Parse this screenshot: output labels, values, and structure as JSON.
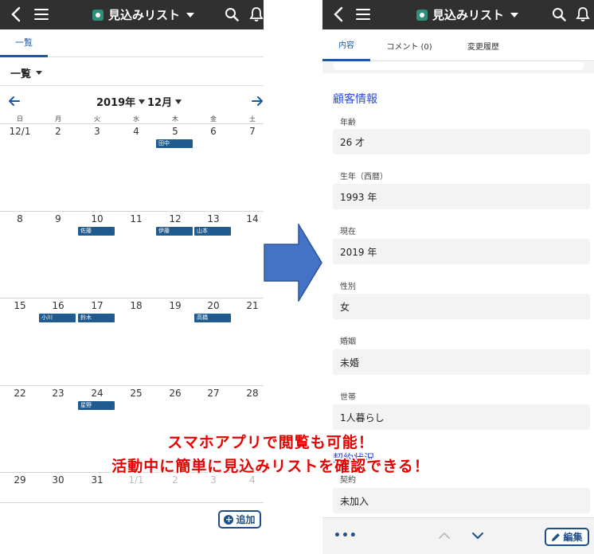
{
  "app_title": "見込みリスト",
  "left": {
    "tab_label": "一覧",
    "view_label": "一覧",
    "year_label": "2019年",
    "month_label": "12月",
    "weekdays": [
      "日",
      "月",
      "火",
      "水",
      "木",
      "金",
      "土"
    ],
    "weeks": [
      [
        "12/1",
        "2",
        "3",
        "4",
        "5",
        "6",
        "7"
      ],
      [
        "8",
        "9",
        "10",
        "11",
        "12",
        "13",
        "14"
      ],
      [
        "15",
        "16",
        "17",
        "18",
        "19",
        "20",
        "21"
      ],
      [
        "22",
        "23",
        "24",
        "25",
        "26",
        "27",
        "28"
      ],
      [
        "29",
        "30",
        "31",
        "1/1",
        "2",
        "3",
        "4"
      ]
    ],
    "events": [
      {
        "week": 0,
        "day": 4,
        "name": "田中"
      },
      {
        "week": 1,
        "day": 2,
        "name": "佐藤"
      },
      {
        "week": 1,
        "day": 4,
        "name": "伊藤"
      },
      {
        "week": 1,
        "day": 5,
        "name": "山本"
      },
      {
        "week": 2,
        "day": 1,
        "name": "小川"
      },
      {
        "week": 2,
        "day": 2,
        "name": "鈴木"
      },
      {
        "week": 2,
        "day": 5,
        "name": "高橋"
      },
      {
        "week": 3,
        "day": 2,
        "name": "星野"
      }
    ],
    "add_label": "追加"
  },
  "right": {
    "tabs": [
      "内容",
      "コメント (0)",
      "変更履歴"
    ],
    "section_title": "顧客情報",
    "fields": [
      {
        "label": "年齢",
        "value": "26 才"
      },
      {
        "label": "生年（西暦）",
        "value": "1993 年"
      },
      {
        "label": "現在",
        "value": "2019 年"
      },
      {
        "label": "性別",
        "value": "女"
      },
      {
        "label": "婚姻",
        "value": "未婚"
      },
      {
        "label": "世帯",
        "value": "1人暮らし"
      },
      {
        "label": "契約",
        "value": "未加入"
      }
    ],
    "section2_title": "契約状況",
    "more_label": "•••",
    "edit_label": "編集"
  },
  "caption": {
    "line1": "スマホアプリで閲覧も可能！",
    "line2": "活動中に簡単に見込みリストを確認できる！"
  },
  "colors": {
    "topbar": "#303030",
    "accent": "#1b5aa3",
    "event": "#1f5b8f",
    "arrow": "#4472c4",
    "caption": "#e60000",
    "section_title": "#2b4bd6"
  }
}
